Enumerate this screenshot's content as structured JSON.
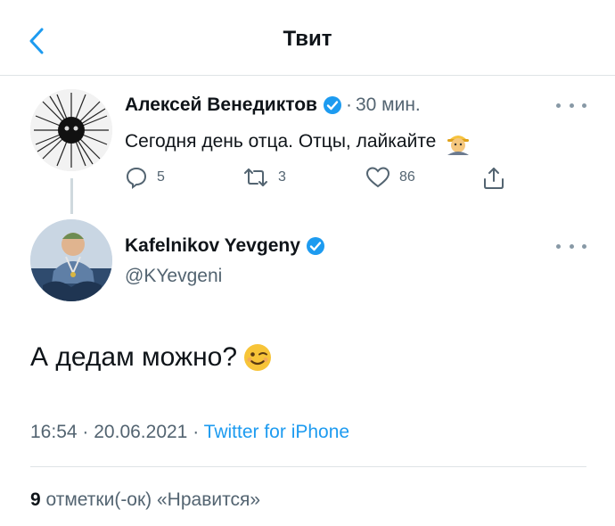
{
  "header": {
    "title": "Твит",
    "back_icon": "chevron-left-icon"
  },
  "parent_tweet": {
    "author_name": "Алексей Венедиктов",
    "separator": "·",
    "time_ago": "30 мин.",
    "text": "Сегодня день отца. Отцы, лайкайте",
    "replies": "5",
    "retweets": "3",
    "likes": "86"
  },
  "tweet": {
    "author_name": "Kafelnikov Yevgeny",
    "handle": "@KYevgeni",
    "text": "А дедам можно?",
    "time": "16:54",
    "separator": "·",
    "date": "20.06.2021",
    "source": "Twitter for iPhone",
    "likes_count": "9",
    "likes_label": "отметки(-ок) «Нравится»"
  },
  "colors": {
    "accent": "#1d9bf0",
    "secondary_text": "#536471",
    "divider": "#dfe3e6"
  }
}
